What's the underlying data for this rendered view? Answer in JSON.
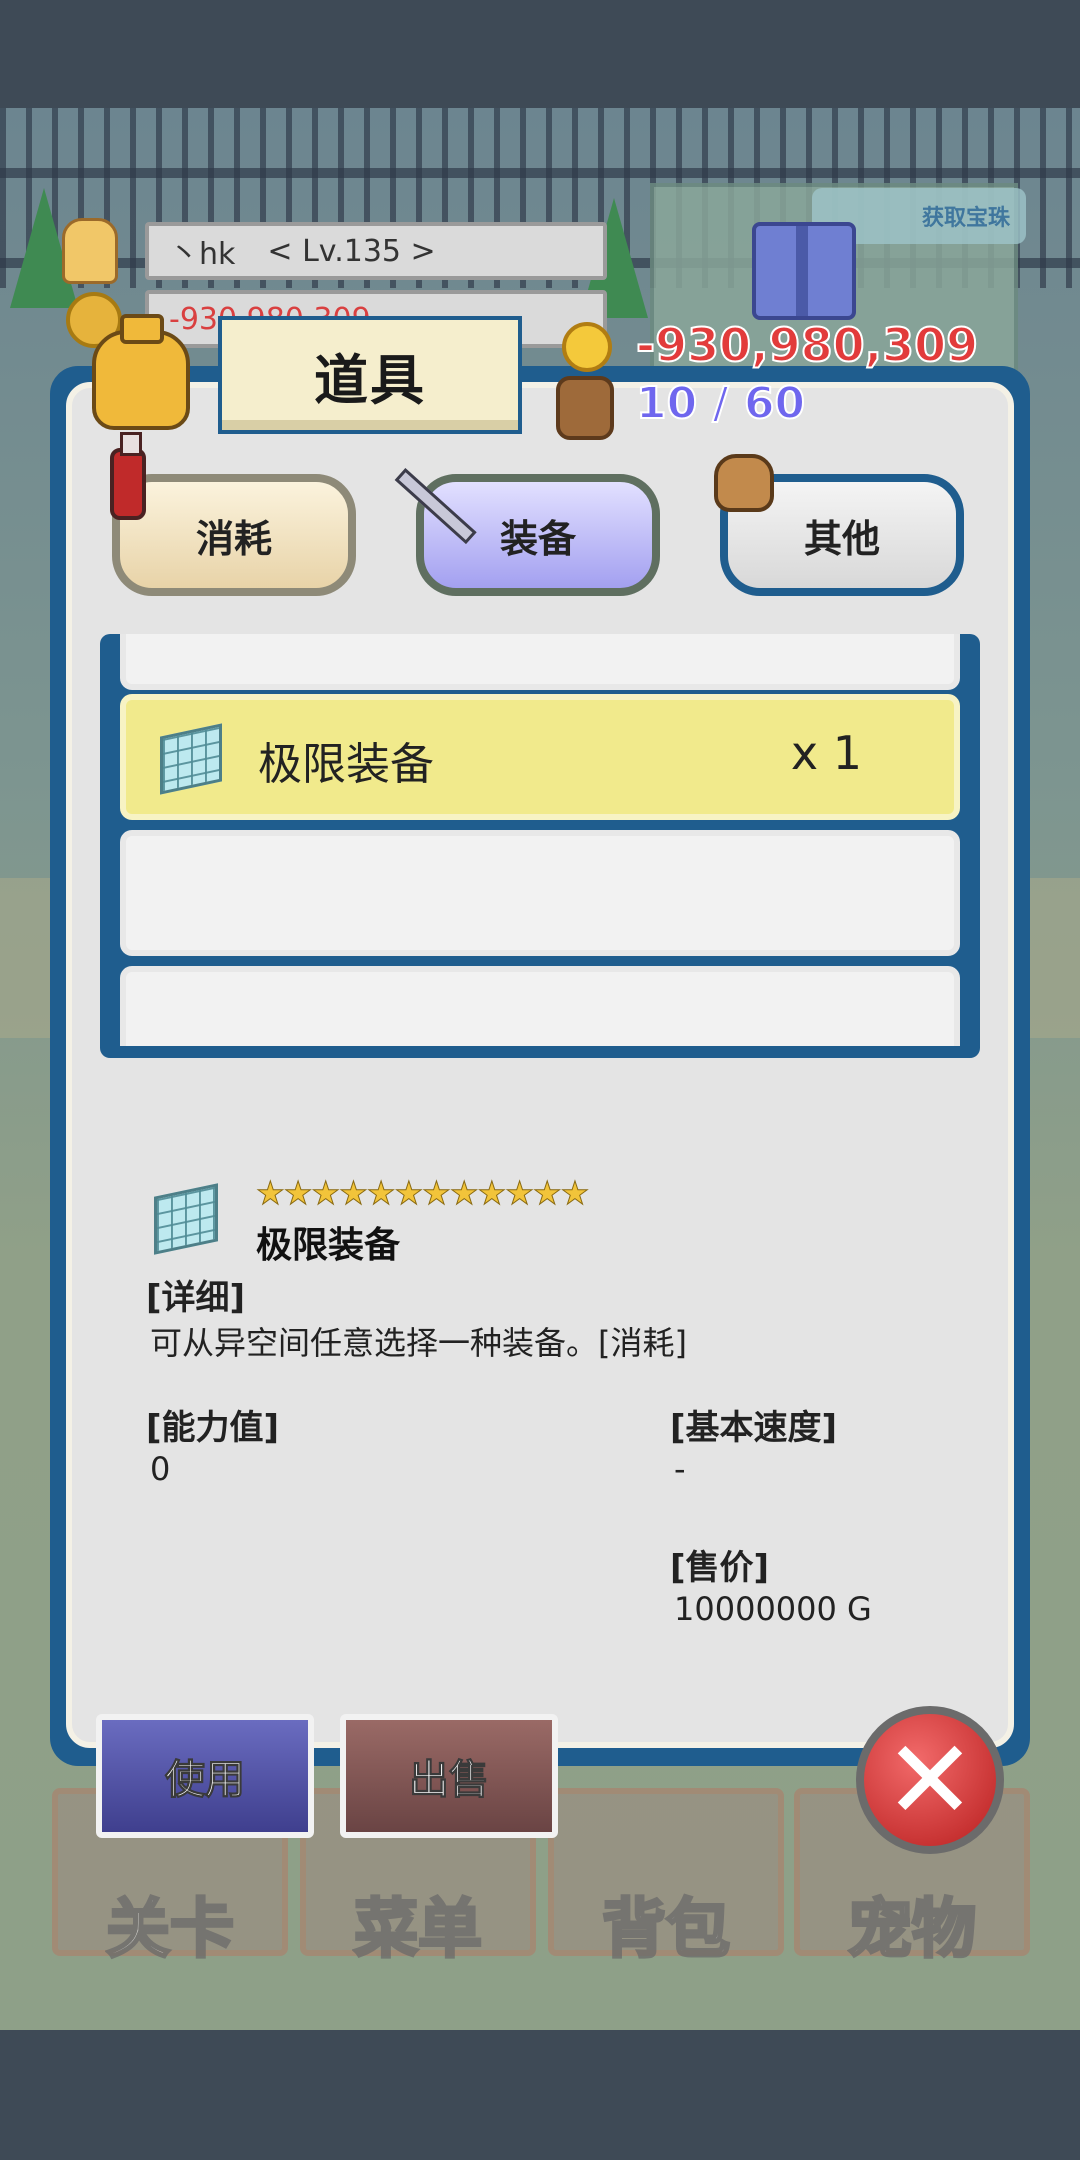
{
  "hud": {
    "player_name": "丶hk",
    "player_level": "< Lv.135 >",
    "player_gold_partial": "-930,980,309",
    "ad_button_label": "获取宝珠"
  },
  "bottom_nav": [
    {
      "label": "关卡"
    },
    {
      "label": "菜单"
    },
    {
      "label": "背包"
    },
    {
      "label": "宠物"
    }
  ],
  "dialog": {
    "title": "道具",
    "gold": "-930,980,309",
    "capacity": "10 / 60",
    "tabs": [
      {
        "label": "消耗"
      },
      {
        "label": "装备"
      },
      {
        "label": "其他"
      }
    ],
    "selected_tab": "装备",
    "items": [
      {
        "name": "",
        "qty": ""
      },
      {
        "name": "极限装备",
        "qty": "x 1",
        "selected": true
      },
      {
        "name": "",
        "qty": ""
      },
      {
        "name": "",
        "qty": ""
      }
    ],
    "detail": {
      "stars": 12,
      "stars_text": "★★★★★★★★★★★★",
      "name": "极限装备",
      "desc_label": "[详细]",
      "desc": "可从异空间任意选择一种装备。[消耗]",
      "ability_label": "[能力值]",
      "ability_value": "0",
      "speed_label": "[基本速度]",
      "speed_value": "-",
      "price_label": "[售价]",
      "price_value": "10000000 G"
    },
    "buttons": {
      "use": "使用",
      "sell": "出售",
      "close": "✕"
    }
  }
}
